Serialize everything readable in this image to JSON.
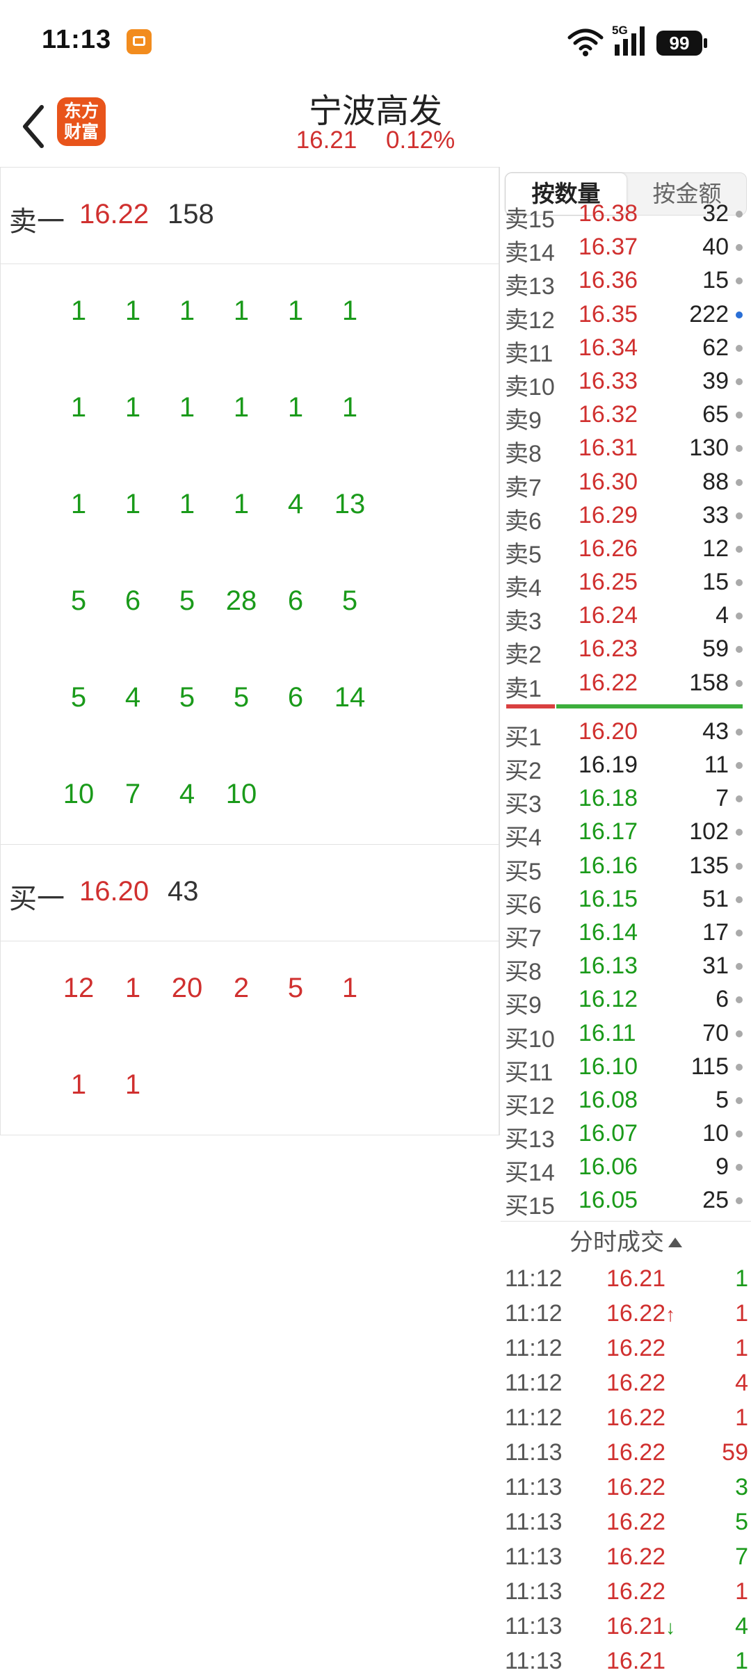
{
  "status_bar": {
    "time": "11:13",
    "battery": "99",
    "network": "5G"
  },
  "header": {
    "title": "宁波高发",
    "price": "16.21",
    "change_pct": "0.12%",
    "logo_line1": "东方",
    "logo_line2": "财富"
  },
  "left": {
    "sell1_label": "卖一",
    "sell1_price": "16.22",
    "sell1_qty": "158",
    "sell_queue": [
      [
        "1",
        "1",
        "1",
        "1",
        "1",
        "1"
      ],
      [
        "1",
        "1",
        "1",
        "1",
        "1",
        "1"
      ],
      [
        "1",
        "1",
        "1",
        "1",
        "4",
        "13"
      ],
      [
        "5",
        "6",
        "5",
        "28",
        "6",
        "5"
      ],
      [
        "5",
        "4",
        "5",
        "5",
        "6",
        "14"
      ],
      [
        "10",
        "7",
        "4",
        "10",
        "",
        ""
      ]
    ],
    "buy1_label": "买一",
    "buy1_price": "16.20",
    "buy1_qty": "43",
    "buy_queue": [
      [
        "12",
        "1",
        "20",
        "2",
        "5",
        "1"
      ],
      [
        "1",
        "1",
        "",
        "",
        "",
        ""
      ]
    ]
  },
  "tabs": {
    "by_volume": "按数量",
    "by_amount": "按金额"
  },
  "order_book": {
    "sells": [
      {
        "label": "卖15",
        "price": "16.38",
        "qty": "32",
        "pc": "r",
        "dot": "grey"
      },
      {
        "label": "卖14",
        "price": "16.37",
        "qty": "40",
        "pc": "r",
        "dot": "grey"
      },
      {
        "label": "卖13",
        "price": "16.36",
        "qty": "15",
        "pc": "r",
        "dot": "grey"
      },
      {
        "label": "卖12",
        "price": "16.35",
        "qty": "222",
        "pc": "r",
        "dot": "blue"
      },
      {
        "label": "卖11",
        "price": "16.34",
        "qty": "62",
        "pc": "r",
        "dot": "grey"
      },
      {
        "label": "卖10",
        "price": "16.33",
        "qty": "39",
        "pc": "r",
        "dot": "grey"
      },
      {
        "label": "卖9",
        "price": "16.32",
        "qty": "65",
        "pc": "r",
        "dot": "grey"
      },
      {
        "label": "卖8",
        "price": "16.31",
        "qty": "130",
        "pc": "r",
        "dot": "grey"
      },
      {
        "label": "卖7",
        "price": "16.30",
        "qty": "88",
        "pc": "r",
        "dot": "grey"
      },
      {
        "label": "卖6",
        "price": "16.29",
        "qty": "33",
        "pc": "r",
        "dot": "grey"
      },
      {
        "label": "卖5",
        "price": "16.26",
        "qty": "12",
        "pc": "r",
        "dot": "grey"
      },
      {
        "label": "卖4",
        "price": "16.25",
        "qty": "15",
        "pc": "r",
        "dot": "grey"
      },
      {
        "label": "卖3",
        "price": "16.24",
        "qty": "4",
        "pc": "r",
        "dot": "grey"
      },
      {
        "label": "卖2",
        "price": "16.23",
        "qty": "59",
        "pc": "r",
        "dot": "grey"
      },
      {
        "label": "卖1",
        "price": "16.22",
        "qty": "158",
        "pc": "r",
        "dot": "grey"
      }
    ],
    "buys": [
      {
        "label": "买1",
        "price": "16.20",
        "qty": "43",
        "pc": "r",
        "dot": "grey"
      },
      {
        "label": "买2",
        "price": "16.19",
        "qty": "11",
        "pc": "k",
        "dot": "grey"
      },
      {
        "label": "买3",
        "price": "16.18",
        "qty": "7",
        "pc": "g",
        "dot": "grey"
      },
      {
        "label": "买4",
        "price": "16.17",
        "qty": "102",
        "pc": "g",
        "dot": "grey"
      },
      {
        "label": "买5",
        "price": "16.16",
        "qty": "135",
        "pc": "g",
        "dot": "grey"
      },
      {
        "label": "买6",
        "price": "16.15",
        "qty": "51",
        "pc": "g",
        "dot": "grey"
      },
      {
        "label": "买7",
        "price": "16.14",
        "qty": "17",
        "pc": "g",
        "dot": "grey"
      },
      {
        "label": "买8",
        "price": "16.13",
        "qty": "31",
        "pc": "g",
        "dot": "grey"
      },
      {
        "label": "买9",
        "price": "16.12",
        "qty": "6",
        "pc": "g",
        "dot": "grey"
      },
      {
        "label": "买10",
        "price": "16.11",
        "qty": "70",
        "pc": "g",
        "dot": "grey"
      },
      {
        "label": "买11",
        "price": "16.10",
        "qty": "115",
        "pc": "g",
        "dot": "grey"
      },
      {
        "label": "买12",
        "price": "16.08",
        "qty": "5",
        "pc": "g",
        "dot": "grey"
      },
      {
        "label": "买13",
        "price": "16.07",
        "qty": "10",
        "pc": "g",
        "dot": "grey"
      },
      {
        "label": "买14",
        "price": "16.06",
        "qty": "9",
        "pc": "g",
        "dot": "grey"
      },
      {
        "label": "买15",
        "price": "16.05",
        "qty": "25",
        "pc": "g",
        "dot": "grey"
      }
    ]
  },
  "ticks_header": "分时成交",
  "ticks": [
    {
      "time": "11:12",
      "price": "16.21",
      "arrow": "",
      "qty": "1",
      "qc": "g"
    },
    {
      "time": "11:12",
      "price": "16.22",
      "arrow": "↑",
      "qty": "1",
      "qc": "r"
    },
    {
      "time": "11:12",
      "price": "16.22",
      "arrow": "",
      "qty": "1",
      "qc": "r"
    },
    {
      "time": "11:12",
      "price": "16.22",
      "arrow": "",
      "qty": "4",
      "qc": "r"
    },
    {
      "time": "11:12",
      "price": "16.22",
      "arrow": "",
      "qty": "1",
      "qc": "r"
    },
    {
      "time": "11:13",
      "price": "16.22",
      "arrow": "",
      "qty": "59",
      "qc": "r"
    },
    {
      "time": "11:13",
      "price": "16.22",
      "arrow": "",
      "qty": "3",
      "qc": "g"
    },
    {
      "time": "11:13",
      "price": "16.22",
      "arrow": "",
      "qty": "5",
      "qc": "g"
    },
    {
      "time": "11:13",
      "price": "16.22",
      "arrow": "",
      "qty": "7",
      "qc": "g"
    },
    {
      "time": "11:13",
      "price": "16.22",
      "arrow": "",
      "qty": "1",
      "qc": "r"
    },
    {
      "time": "11:13",
      "price": "16.21",
      "arrow": "↓",
      "qty": "4",
      "qc": "g"
    },
    {
      "time": "11:13",
      "price": "16.21",
      "arrow": "",
      "qty": "1",
      "qc": "g"
    }
  ],
  "colors": {
    "up": "#d0302f",
    "down": "#1a9a1a",
    "neutral": "#222222",
    "accent_blue": "#2a6fd6"
  }
}
